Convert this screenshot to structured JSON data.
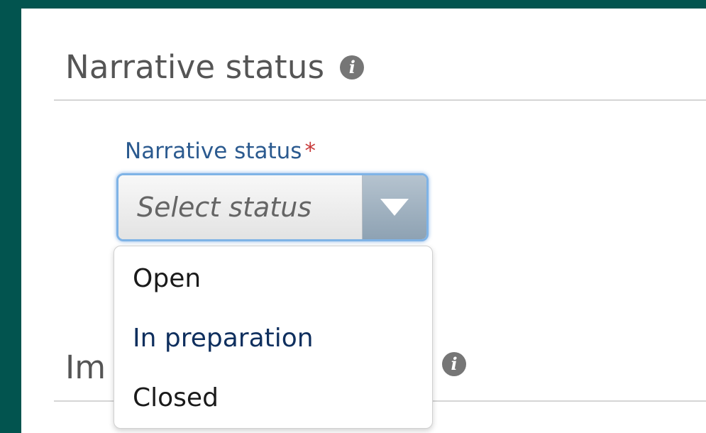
{
  "section": {
    "title": "Narrative status",
    "info_icon": "info-icon"
  },
  "field": {
    "label": "Narrative status",
    "required_marker": "*",
    "placeholder": "Select status",
    "arrow_icon": "triangle-down-icon"
  },
  "dropdown": {
    "options": [
      "Open",
      "In preparation",
      "Closed"
    ],
    "hovered_option": "In preparation"
  },
  "section2": {
    "title_visible_fragment": "Im",
    "info_icon": "info-icon"
  },
  "colors": {
    "frame_background": "#02544f",
    "label_blue": "#2b5a8f",
    "required_red": "#c83a3a",
    "focus_ring": "#7fb3e6"
  }
}
